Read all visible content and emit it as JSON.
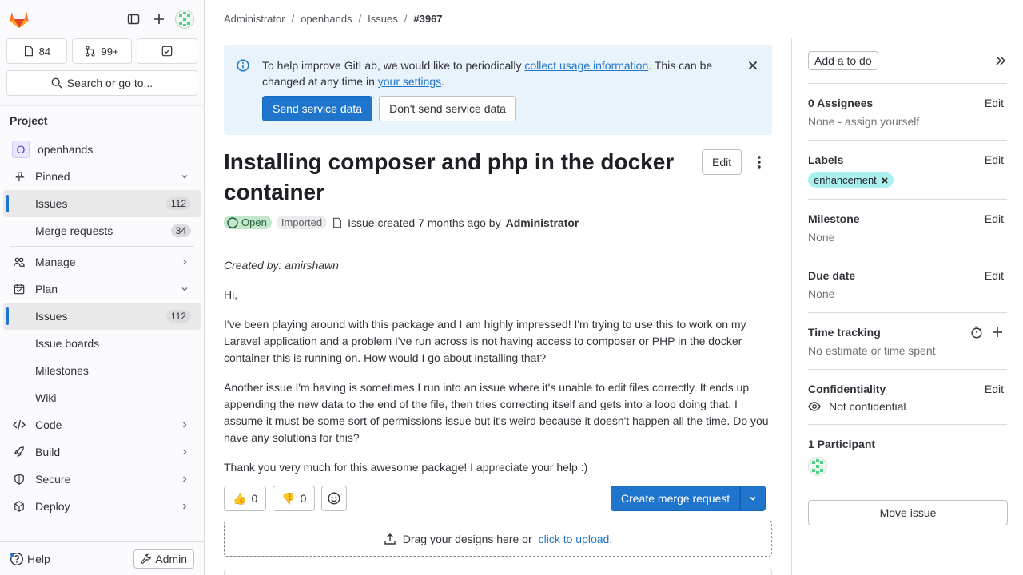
{
  "sidebar": {
    "counts": {
      "issues": "84",
      "merge_requests": "99+"
    },
    "search_label": "Search or go to...",
    "section": "Project",
    "project_name": "openhands",
    "project_initial": "O",
    "pinned": {
      "label": "Pinned",
      "items": [
        {
          "label": "Issues",
          "count": "112"
        },
        {
          "label": "Merge requests",
          "count": "34"
        }
      ]
    },
    "manage": "Manage",
    "plan": {
      "label": "Plan",
      "items": [
        {
          "label": "Issues",
          "count": "112"
        },
        {
          "label": "Issue boards"
        },
        {
          "label": "Milestones"
        },
        {
          "label": "Wiki"
        }
      ]
    },
    "code": "Code",
    "build": "Build",
    "secure": "Secure",
    "deploy": "Deploy",
    "help": "Help",
    "admin": "Admin"
  },
  "breadcrumb": [
    "Administrator",
    "openhands",
    "Issues",
    "#3967"
  ],
  "banner": {
    "text_before": "To help improve GitLab, we would like to periodically ",
    "link1": "collect usage information",
    "text_middle": ". This can be changed at any time in ",
    "link2": "your settings",
    "text_after": ".",
    "send_btn": "Send service data",
    "dont_send_btn": "Don't send service data"
  },
  "issue": {
    "title": "Installing composer and php in the docker container",
    "edit_btn": "Edit",
    "status": "Open",
    "imported": "Imported",
    "created_text": "Issue created 7 months ago by",
    "author": "Administrator",
    "created_by": "Created by: amirshawn",
    "paragraphs": [
      "Hi,",
      "I've been playing around with this package and I am highly impressed! I'm trying to use this to work on my Laravel application and a problem I've run across is not having access to composer or PHP in the docker container this is running on. How would I go about installing that?",
      "Another issue I'm having is sometimes I run into an issue where it's unable to edit files correctly. It ends up appending the new data to the end of the file, then tries correcting itself and gets into a loop doing that. I assume it must be some sort of permissions issue but it's weird because it doesn't happen all the time. Do you have any solutions for this?",
      "Thank you very much for this awesome package! I appreciate your help :)"
    ],
    "thumbs_up": "0",
    "thumbs_down": "0",
    "create_mr": "Create merge request",
    "drop_text": "Drag your designs here or",
    "drop_link": "click to upload",
    "drop_after": "."
  },
  "right_sidebar": {
    "todo_btn": "Add a to do",
    "assignees": {
      "title": "0 Assignees",
      "edit": "Edit",
      "value": "None - assign yourself"
    },
    "labels": {
      "title": "Labels",
      "edit": "Edit",
      "label": "enhancement"
    },
    "milestone": {
      "title": "Milestone",
      "edit": "Edit",
      "value": "None"
    },
    "due_date": {
      "title": "Due date",
      "edit": "Edit",
      "value": "None"
    },
    "time_tracking": {
      "title": "Time tracking",
      "value": "No estimate or time spent"
    },
    "confidentiality": {
      "title": "Confidentiality",
      "edit": "Edit",
      "value": "Not confidential"
    },
    "participants": {
      "title": "1 Participant"
    },
    "move_btn": "Move issue"
  },
  "colors": {
    "accent": "#1f75cb",
    "open_badge": "#c3e6cd",
    "label_bg": "#aaf0ee",
    "banner_bg": "#e9f3fc"
  }
}
